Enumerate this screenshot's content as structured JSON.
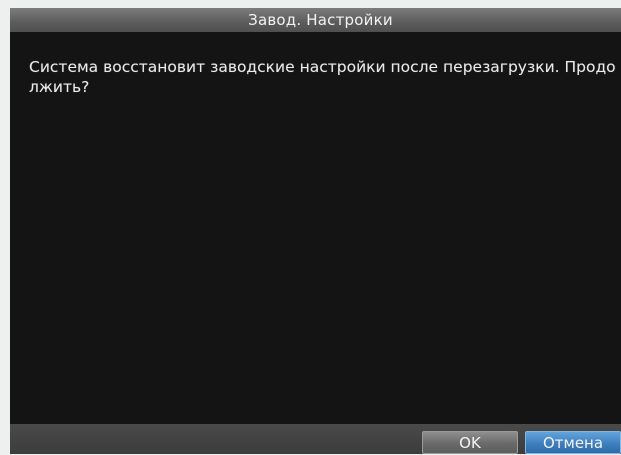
{
  "dialog": {
    "title": "Завод. Настройки",
    "message": "Система восстановит заводские настройки после перезагрузки. Продолжить?",
    "ok_label": "OK",
    "cancel_label": "Отмена"
  },
  "colors": {
    "background": "#141414",
    "title_bar": "#6a6a6a",
    "button_ok": "#707070",
    "button_cancel_selected": "#3f7fbf",
    "text": "#eaeaea"
  }
}
